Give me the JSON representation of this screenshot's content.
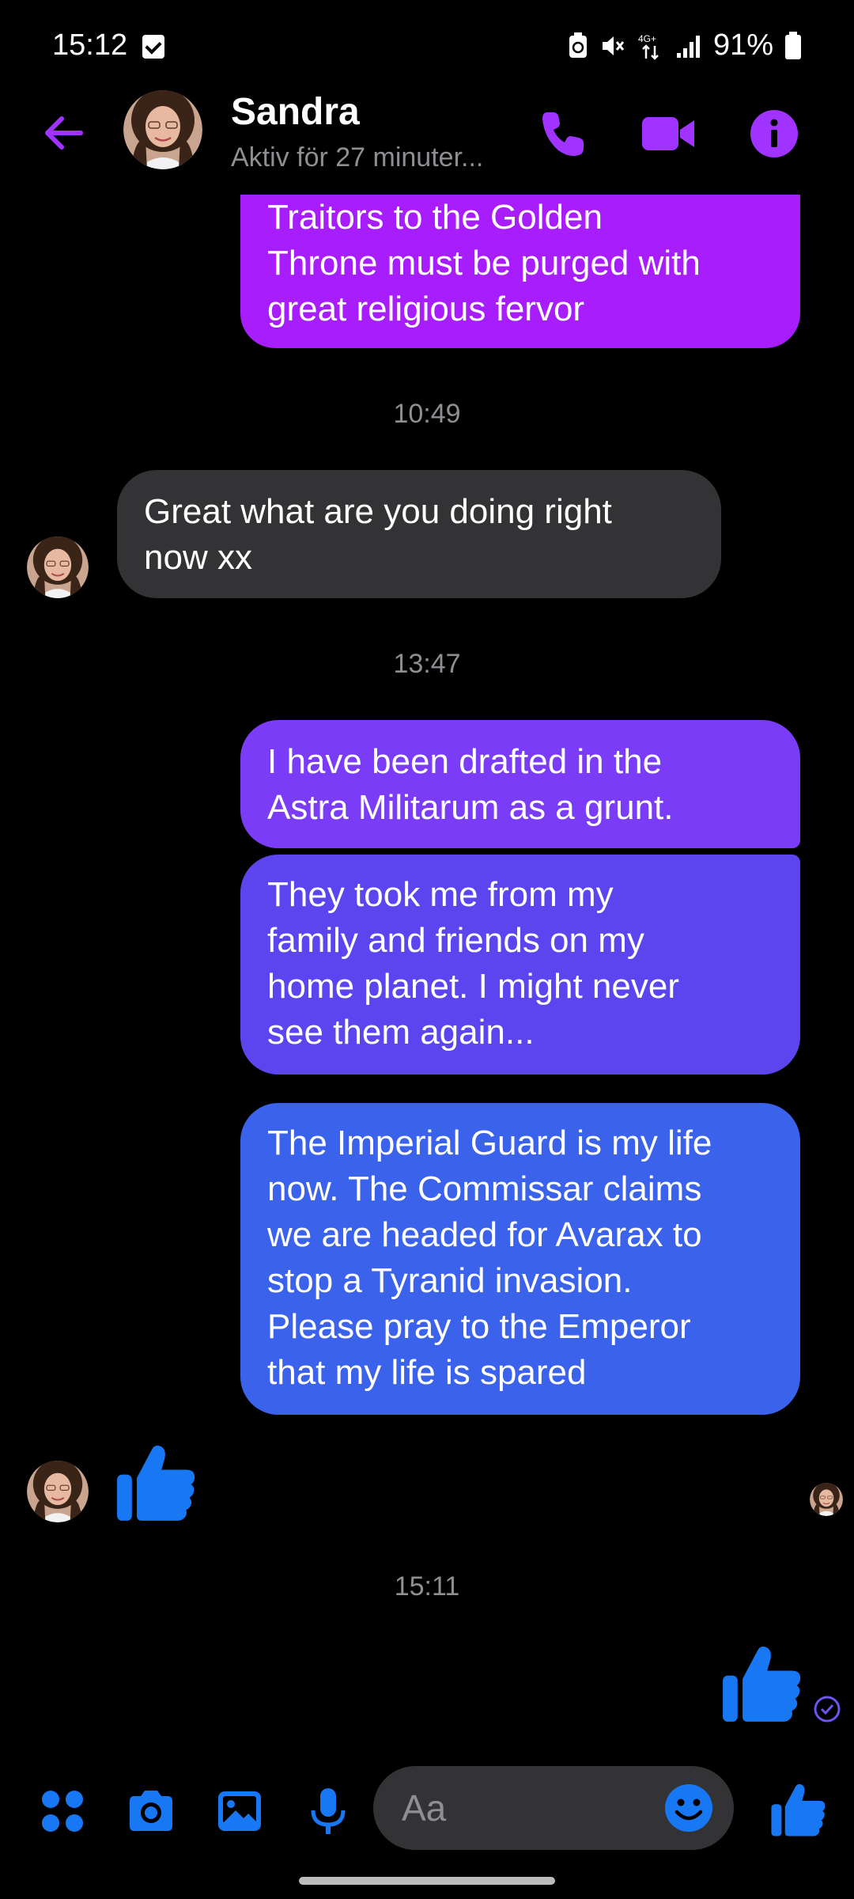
{
  "status_bar": {
    "time": "15:12",
    "battery": "91%"
  },
  "header": {
    "contact_name": "Sandra",
    "contact_status": "Aktiv för 27 minuter..."
  },
  "messages": {
    "m1": "Traitors to the Golden\nThrone must be purged with\ngreat religious fervor",
    "ts1": "10:49",
    "m2": "Great what are you doing right\nnow xx",
    "ts2": "13:47",
    "m3": "I have been drafted in the\nAstra Militarum as a grunt.",
    "m4": "They took me from my\nfamily and friends on my\nhome planet. I might never\nsee them again...",
    "m5": "The Imperial Guard is my life\nnow. The Commissar claims\nwe are headed for Avarax to\nstop a Tyranid invasion.\nPlease pray to the Emperor\nthat my life is spared",
    "ts3": "15:11"
  },
  "composer": {
    "placeholder": "Aa"
  },
  "colors": {
    "accent_purple": "#a033ff",
    "bubble_incoming": "#333336",
    "like_blue": "#1877f2"
  },
  "icons": {
    "back": "arrow-left-icon",
    "call": "phone-icon",
    "video": "video-camera-icon",
    "info": "info-icon",
    "like": "thumbs-up-icon"
  }
}
